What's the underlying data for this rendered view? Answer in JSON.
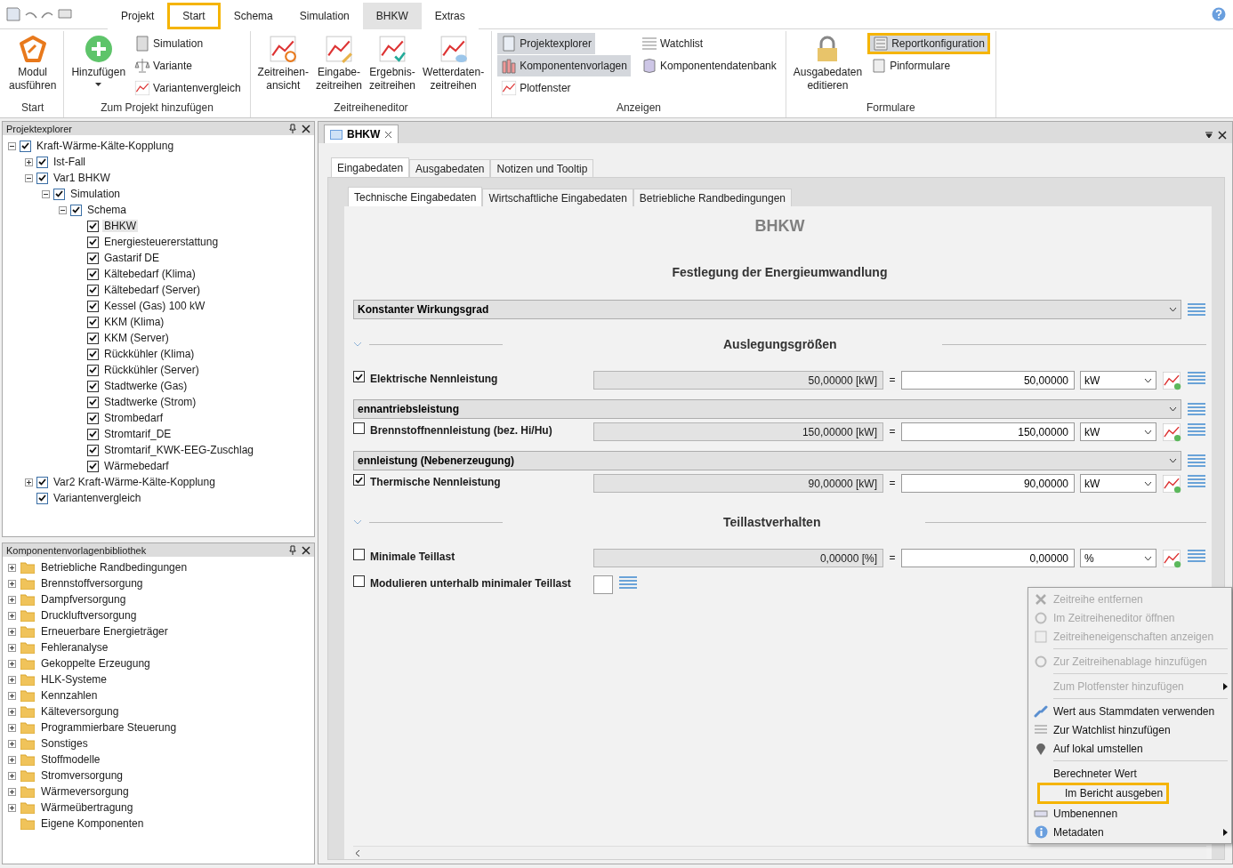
{
  "ribbon_tabs": [
    {
      "label": "Projekt",
      "selected": false
    },
    {
      "label": "Start",
      "selected": false,
      "annotated": true
    },
    {
      "label": "Schema",
      "selected": false
    },
    {
      "label": "Simulation",
      "selected": false
    },
    {
      "label": "BHKW",
      "selected": true
    },
    {
      "label": "Extras",
      "selected": false
    }
  ],
  "ribbon_groups": [
    {
      "label": "Start",
      "items": [
        {
          "kind": "large",
          "label": "Modul\nausführen"
        }
      ]
    },
    {
      "label": "Zum Projekt hinzufügen",
      "items": [
        {
          "kind": "large",
          "label": "Hinzufügen",
          "dropdown": true
        },
        {
          "kind": "small",
          "label": "Simulation",
          "active": false
        },
        {
          "kind": "small",
          "label": "Variante",
          "active": false
        },
        {
          "kind": "small",
          "label": "Variantenvergleich",
          "active": false
        }
      ]
    },
    {
      "label": "Zeitreiheneditor",
      "items": [
        {
          "kind": "large",
          "label": "Zeitreihen-\nansicht"
        },
        {
          "kind": "large",
          "label": "Eingabe-\nzeitreihen"
        },
        {
          "kind": "large",
          "label": "Ergebnis-\nzeitreihen"
        },
        {
          "kind": "large",
          "label": "Wetterdaten-\nzeitreihen"
        }
      ]
    },
    {
      "label": "Anzeigen",
      "items": [
        {
          "kind": "small",
          "label": "Projektexplorer",
          "active": true
        },
        {
          "kind": "small",
          "label": "Komponentenvorlagen",
          "active": true
        },
        {
          "kind": "small",
          "label": "Plotfenster",
          "active": false
        },
        {
          "kind": "small",
          "label": "Watchlist",
          "active": false
        },
        {
          "kind": "small",
          "label": "Komponentendatenbank",
          "active": false
        }
      ]
    },
    {
      "label": "Formulare",
      "items": [
        {
          "kind": "large",
          "label": "Ausgabedaten\neditieren"
        },
        {
          "kind": "small",
          "label": "Reportkonfiguration",
          "active": true,
          "annotated": true
        },
        {
          "kind": "small",
          "label": "Pinformulare",
          "active": false
        }
      ]
    }
  ],
  "project_explorer": {
    "title": "Projektexplorer",
    "tree": [
      {
        "label": "Kraft-Wärme-Kälte-Kopplung",
        "checked": true,
        "selected": false,
        "expanded": true,
        "children": [
          {
            "label": "Ist-Fall",
            "checked": true,
            "selected": false,
            "expanded": false
          },
          {
            "label": "Var1 BHKW",
            "checked": true,
            "selected": false,
            "expanded": true,
            "children": [
              {
                "label": "Simulation",
                "checked": true,
                "selected": false,
                "expanded": true,
                "children": [
                  {
                    "label": "Schema",
                    "checked": true,
                    "selected": false,
                    "expanded": true,
                    "children": [
                      {
                        "label": "BHKW",
                        "checked": true,
                        "selected": true
                      },
                      {
                        "label": "Energiesteuererstattung",
                        "checked": true,
                        "selected": false
                      },
                      {
                        "label": "Gastarif DE",
                        "checked": true,
                        "selected": false
                      },
                      {
                        "label": "Kältebedarf (Klima)",
                        "checked": true,
                        "selected": false
                      },
                      {
                        "label": "Kältebedarf (Server)",
                        "checked": true,
                        "selected": false
                      },
                      {
                        "label": "Kessel (Gas) 100 kW",
                        "checked": true,
                        "selected": false
                      },
                      {
                        "label": "KKM (Klima)",
                        "checked": true,
                        "selected": false
                      },
                      {
                        "label": "KKM (Server)",
                        "checked": true,
                        "selected": false
                      },
                      {
                        "label": "Rückkühler (Klima)",
                        "checked": true,
                        "selected": false
                      },
                      {
                        "label": "Rückkühler (Server)",
                        "checked": true,
                        "selected": false
                      },
                      {
                        "label": "Stadtwerke (Gas)",
                        "checked": true,
                        "selected": false
                      },
                      {
                        "label": "Stadtwerke (Strom)",
                        "checked": true,
                        "selected": false
                      },
                      {
                        "label": "Strombedarf",
                        "checked": true,
                        "selected": false
                      },
                      {
                        "label": "Stromtarif_DE",
                        "checked": true,
                        "selected": false
                      },
                      {
                        "label": "Stromtarif_KWK-EEG-Zuschlag",
                        "checked": true,
                        "selected": false
                      },
                      {
                        "label": "Wärmebedarf",
                        "checked": true,
                        "selected": false
                      }
                    ]
                  }
                ]
              }
            ]
          },
          {
            "label": "Var2 Kraft-Wärme-Kälte-Kopplung",
            "checked": true,
            "selected": false,
            "expanded": false
          },
          {
            "label": "Variantenvergleich",
            "checked": true,
            "selected": false
          }
        ]
      }
    ]
  },
  "library": {
    "title": "Komponentenvorlagenbibliothek",
    "items": [
      {
        "label": "Betriebliche Randbedingungen",
        "expanded": false
      },
      {
        "label": "Brennstoffversorgung",
        "expanded": false
      },
      {
        "label": "Dampfversorgung",
        "expanded": false
      },
      {
        "label": "Druckluftversorgung",
        "expanded": false
      },
      {
        "label": "Erneuerbare Energieträger",
        "expanded": false
      },
      {
        "label": "Fehleranalyse",
        "expanded": false
      },
      {
        "label": "Gekoppelte Erzeugung",
        "expanded": false
      },
      {
        "label": "HLK-Systeme",
        "expanded": false
      },
      {
        "label": "Kennzahlen",
        "expanded": false
      },
      {
        "label": "Kälteversorgung",
        "expanded": false
      },
      {
        "label": "Programmierbare Steuerung",
        "expanded": false
      },
      {
        "label": "Sonstiges",
        "expanded": false
      },
      {
        "label": "Stoffmodelle",
        "expanded": false
      },
      {
        "label": "Stromversorgung",
        "expanded": false
      },
      {
        "label": "Wärmeversorgung",
        "expanded": false
      },
      {
        "label": "Wärmeübertragung",
        "expanded": false
      },
      {
        "label": "Eigene Komponenten"
      }
    ]
  },
  "document_tab": {
    "label": "BHKW"
  },
  "tabs": [
    {
      "label": "Eingabedaten",
      "selected": true
    },
    {
      "label": "Ausgabedaten",
      "selected": false
    },
    {
      "label": "Notizen und Tooltip",
      "selected": false
    }
  ],
  "sub_tabs": [
    {
      "label": "Technische Eingabedaten",
      "selected": true
    },
    {
      "label": "Wirtschaftliche Eingabedaten",
      "selected": false
    },
    {
      "label": "Betriebliche Randbedingungen",
      "selected": false
    }
  ],
  "form": {
    "title": "BHKW",
    "rows": [
      {
        "kind": "heading",
        "label": "Festlegung der Energieumwandlung"
      },
      {
        "kind": "select",
        "value": "Konstanter Wirkungsgrad"
      },
      {
        "kind": "section",
        "label": "Auslegungsgrößen",
        "expanded": true
      },
      {
        "kind": "param",
        "label": "Elektrische Nennleistung",
        "checked": true,
        "computed": "50,00000 [kW]",
        "equals": "=",
        "value": "50,00000",
        "unit": "kW"
      },
      {
        "kind": "select",
        "value": "ennantriebsleistung"
      },
      {
        "kind": "param",
        "label": "Brennstoffnennleistung (bez. Hi/Hu)",
        "checked": false,
        "computed": "150,00000 [kW]",
        "equals": "=",
        "value": "150,00000",
        "unit": "kW"
      },
      {
        "kind": "select",
        "value": "ennleistung (Nebenerzeugung)"
      },
      {
        "kind": "param",
        "label": "Thermische Nennleistung",
        "checked": true,
        "computed": "90,00000 [kW]",
        "equals": "=",
        "value": "90,00000",
        "unit": "kW"
      },
      {
        "kind": "section",
        "label": "Teillastverhalten",
        "expanded": true
      },
      {
        "kind": "param",
        "label": "Minimale Teillast",
        "checked": false,
        "computed": "0,00000 [%]",
        "equals": "=",
        "value": "0,00000",
        "unit": "%"
      },
      {
        "kind": "flag",
        "label": "Modulieren unterhalb minimaler Teillast",
        "checked": false
      }
    ]
  },
  "context_menu": [
    {
      "kind": "item",
      "label": "Zeitreihe entfernen",
      "disabled": true
    },
    {
      "kind": "item",
      "label": "Im Zeitreiheneditor öffnen",
      "disabled": true
    },
    {
      "kind": "item",
      "label": "Zeitreiheneigenschaften anzeigen",
      "disabled": true
    },
    {
      "kind": "separator"
    },
    {
      "kind": "item",
      "label": "Zur Zeitreihenablage hinzufügen",
      "disabled": true
    },
    {
      "kind": "separator"
    },
    {
      "kind": "item",
      "label": "Zum Plotfenster hinzufügen",
      "disabled": true,
      "submenu": true
    },
    {
      "kind": "separator"
    },
    {
      "kind": "item",
      "label": "Wert aus Stammdaten verwenden",
      "disabled": false
    },
    {
      "kind": "item",
      "label": "Zur Watchlist hinzufügen",
      "disabled": false
    },
    {
      "kind": "item",
      "label": "Auf lokal umstellen",
      "disabled": false
    },
    {
      "kind": "separator"
    },
    {
      "kind": "item",
      "label": "Berechneter Wert",
      "disabled": false
    },
    {
      "kind": "item",
      "label": "Im Bericht ausgeben",
      "disabled": false,
      "annotated": true
    },
    {
      "kind": "item",
      "label": "Umbenennen",
      "disabled": false
    },
    {
      "kind": "item",
      "label": "Metadaten",
      "disabled": false,
      "submenu": true
    }
  ]
}
